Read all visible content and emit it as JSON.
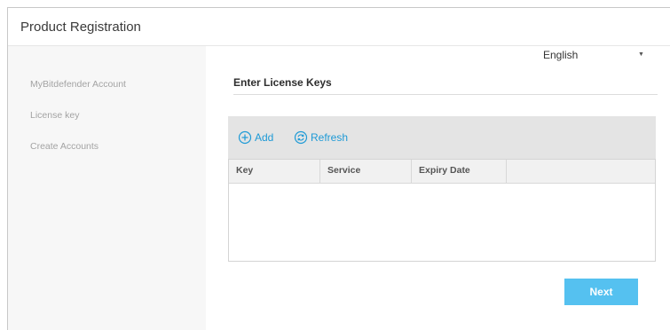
{
  "window": {
    "title": "Product Registration"
  },
  "sidebar": {
    "items": [
      {
        "label": "MyBitdefender Account"
      },
      {
        "label": "License key"
      },
      {
        "label": "Create Accounts"
      }
    ]
  },
  "language": {
    "selected": "English"
  },
  "main": {
    "section_title": "Enter License Keys",
    "toolbar": {
      "add_label": "Add",
      "refresh_label": "Refresh"
    },
    "table": {
      "columns": [
        "Key",
        "Service",
        "Expiry Date",
        ""
      ],
      "rows": []
    },
    "next_label": "Next"
  },
  "colors": {
    "accent": "#1e9ad6",
    "next_button": "#55c1f0",
    "sidebar_bg": "#f7f7f7",
    "toolbar_bg": "#e4e4e4"
  }
}
